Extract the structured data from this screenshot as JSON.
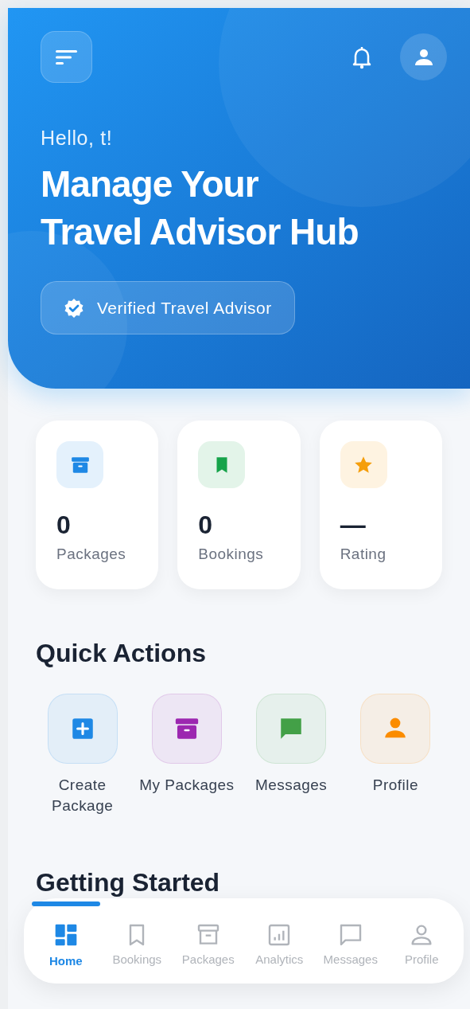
{
  "header": {
    "greeting": "Hello, t!",
    "title": "Manage Your\nTravel Advisor Hub",
    "badge": "Verified Travel Advisor"
  },
  "stats": [
    {
      "kind": "box",
      "value": "0",
      "label": "Packages",
      "color": "#1e88e5"
    },
    {
      "kind": "bookmark",
      "value": "0",
      "label": "Bookings",
      "color": "#16a34a"
    },
    {
      "kind": "star",
      "value": "—",
      "label": "Rating",
      "color": "#f59e0b"
    }
  ],
  "quick_actions": {
    "title": "Quick Actions",
    "items": [
      {
        "kind": "plus",
        "label": "Create Package",
        "color": "#1e88e5"
      },
      {
        "kind": "box",
        "label": "My Packages",
        "color": "#9c27b0"
      },
      {
        "kind": "chat",
        "label": "Messages",
        "color": "#43a047"
      },
      {
        "kind": "person",
        "label": "Profile",
        "color": "#fb8c00"
      }
    ]
  },
  "getting_started": {
    "title": "Getting Started"
  },
  "bottom_nav": [
    {
      "kind": "grid",
      "label": "Home",
      "selected": true
    },
    {
      "kind": "bookmark",
      "label": "Bookings",
      "selected": false
    },
    {
      "kind": "box",
      "label": "Packages",
      "selected": false
    },
    {
      "kind": "chart",
      "label": "Analytics",
      "selected": false
    },
    {
      "kind": "chat",
      "label": "Messages",
      "selected": false
    },
    {
      "kind": "person",
      "label": "Profile",
      "selected": false
    }
  ]
}
